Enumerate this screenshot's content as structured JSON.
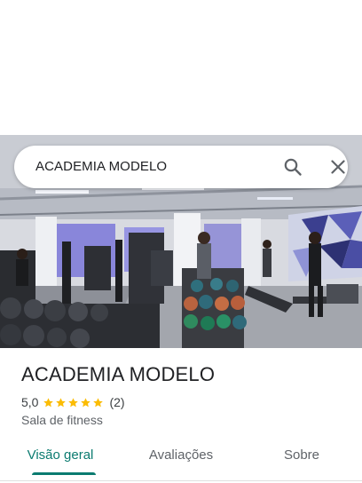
{
  "search": {
    "query": "ACADEMIA MODELO"
  },
  "place": {
    "name": "ACADEMIA MODELO",
    "rating": "5,0",
    "stars": 5,
    "review_count": "(2)",
    "category": "Sala de fitness"
  },
  "tabs": [
    {
      "label": "Visão geral",
      "active": true
    },
    {
      "label": "Avaliações",
      "active": false
    },
    {
      "label": "Sobre",
      "active": false
    }
  ],
  "colors": {
    "accent": "#0b7b70",
    "star": "#fbbc04",
    "text_primary": "#202124",
    "text_secondary": "#5f6368"
  },
  "icons": [
    "search-icon",
    "close-icon",
    "star-icon"
  ]
}
